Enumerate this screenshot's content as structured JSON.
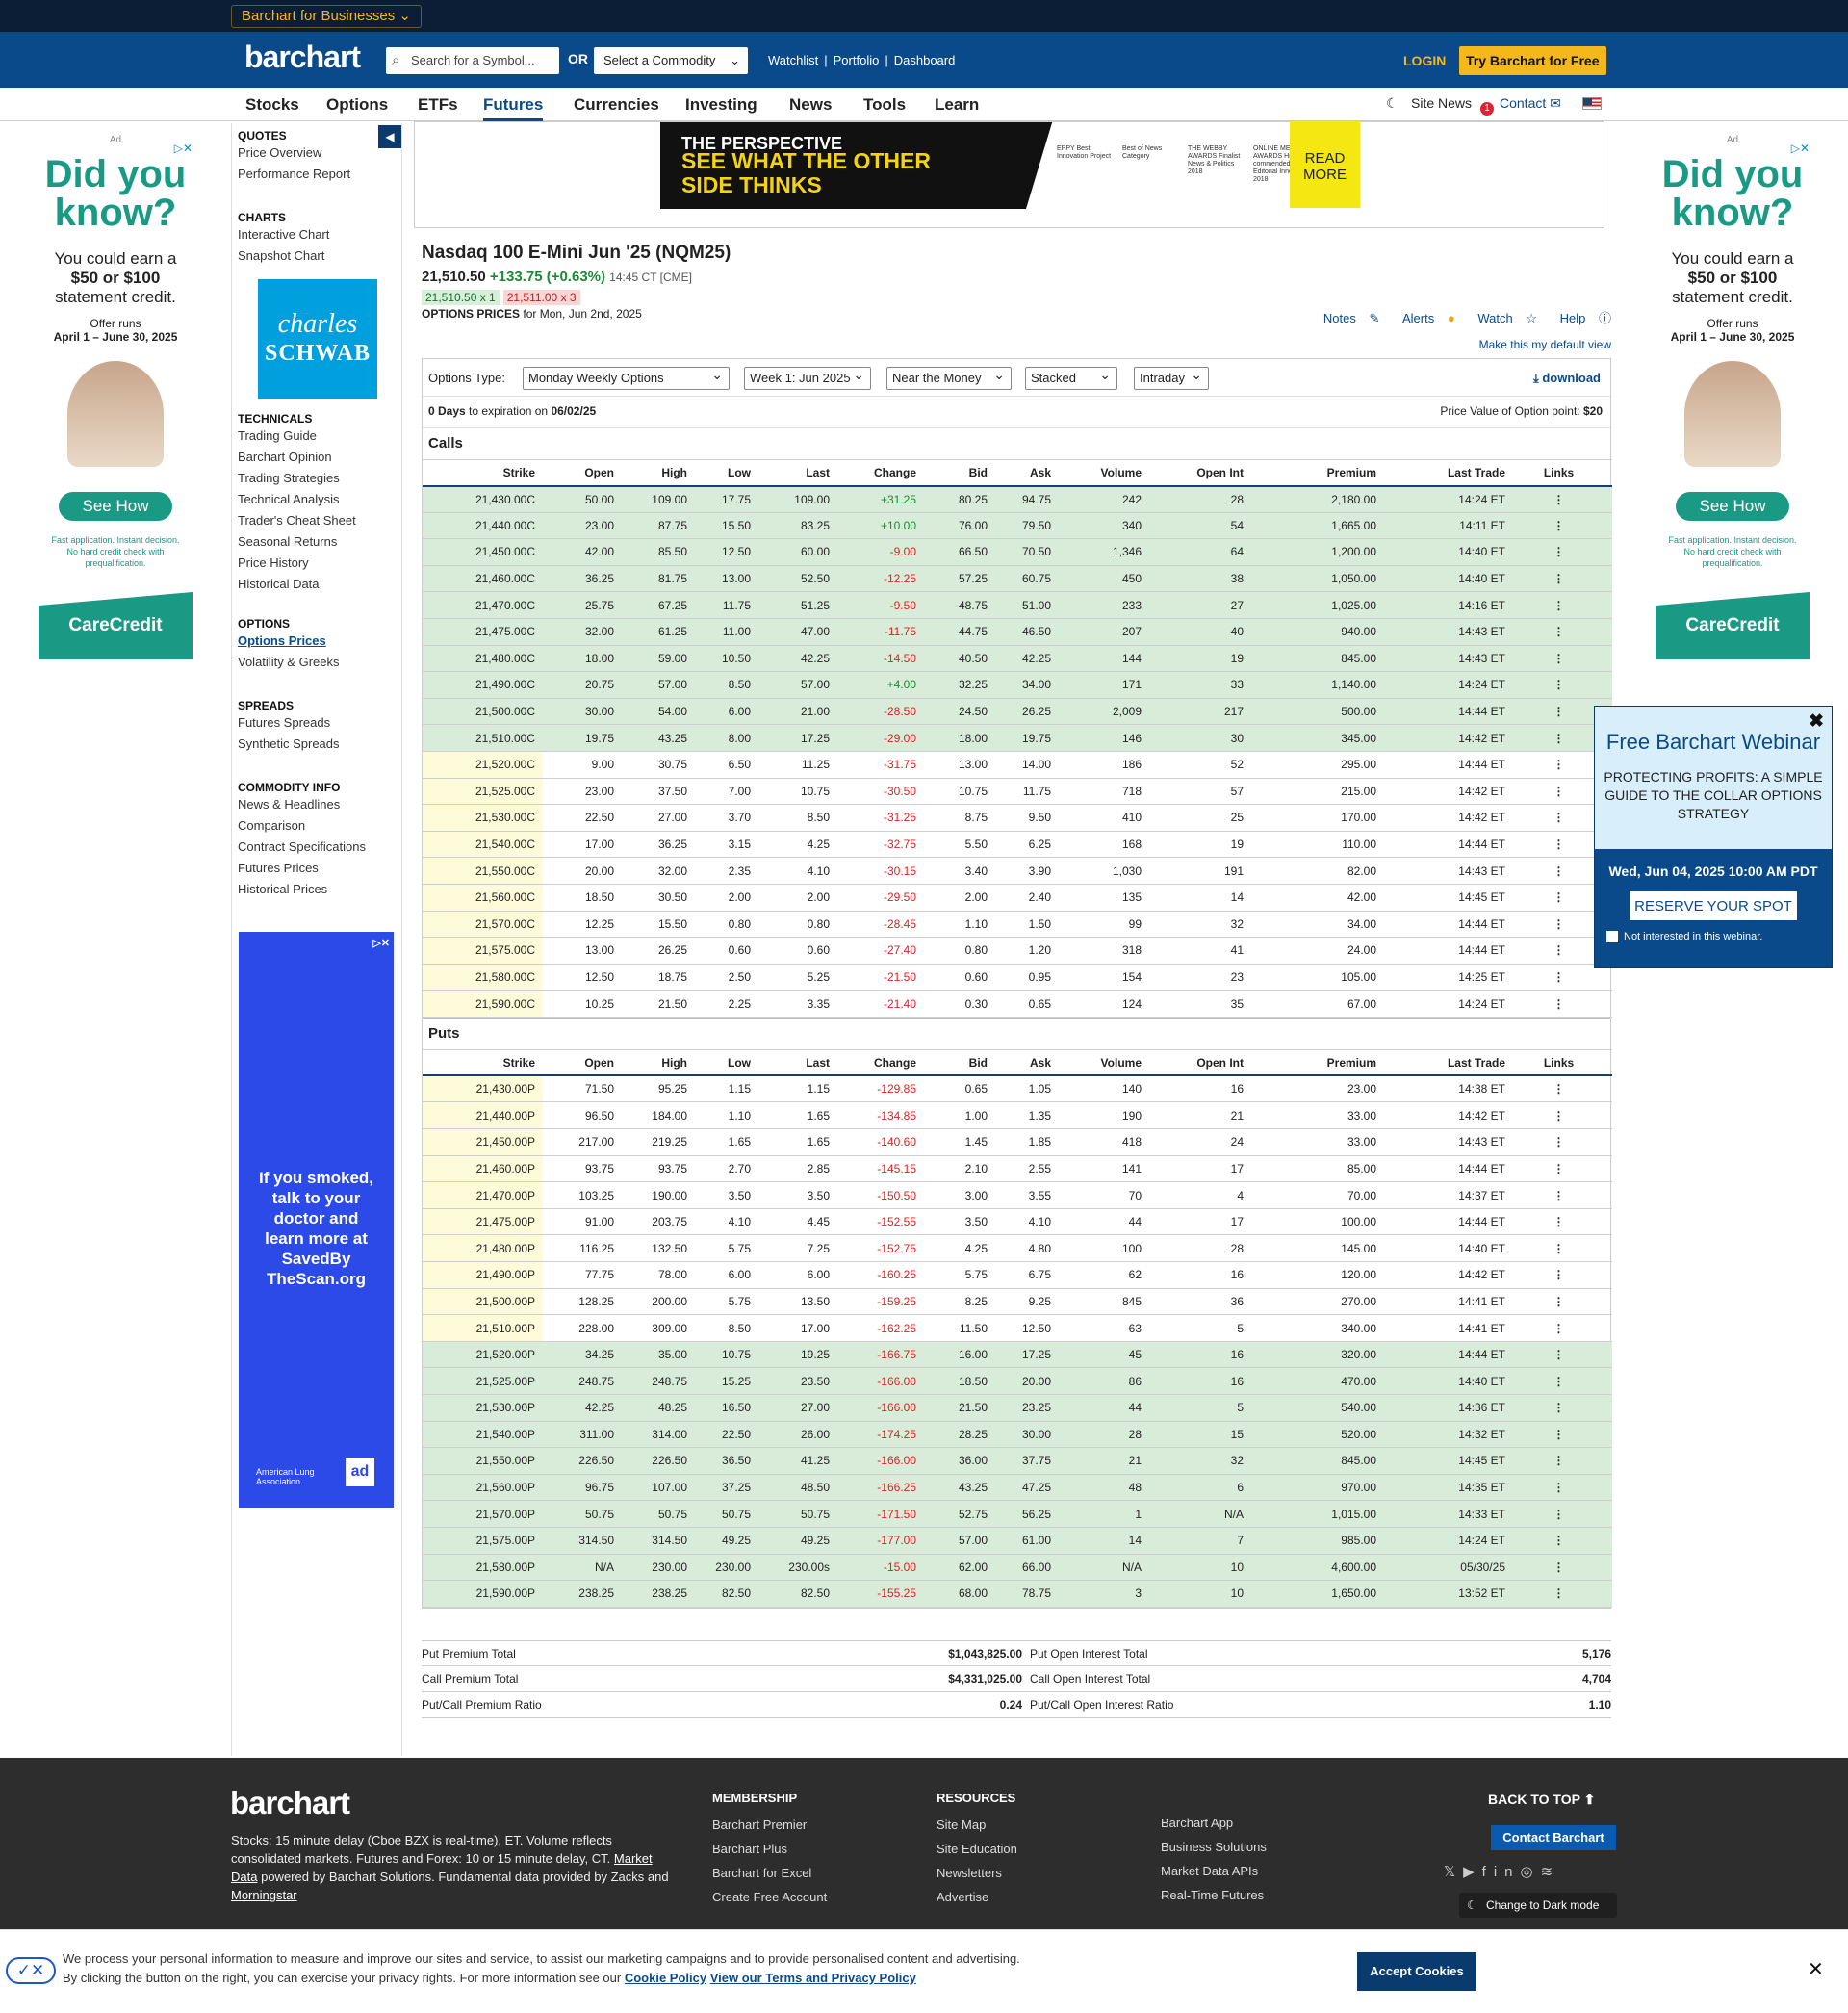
{
  "topbar": {
    "business": "Barchart for Businesses"
  },
  "header": {
    "logo": "barchart",
    "search_placeholder": "Search for a Symbol...",
    "or": "OR",
    "commodity": "Select a Commodity",
    "links": [
      "Watchlist",
      "|",
      "Portfolio",
      "|",
      "Dashboard"
    ],
    "login": "LOGIN",
    "try": "Try Barchart for Free"
  },
  "nav": {
    "items": [
      "Stocks",
      "Options",
      "ETFs",
      "Futures",
      "Currencies",
      "Investing",
      "News",
      "Tools",
      "Learn"
    ],
    "active": "Futures",
    "site_news": "Site News",
    "badge": "1",
    "contact": "Contact"
  },
  "left_ad": {
    "label": "Ad",
    "headline1": "Did you",
    "headline2": "know?",
    "line1": "You could earn a",
    "line2": "$50 or $100",
    "line3": "statement credit.",
    "offer1": "Offer runs",
    "offer2": "April 1 – June 30, 2025",
    "button": "See How",
    "fine": "Fast application. Instant decision. No hard credit check with prequalification.",
    "brand": "CareCredit"
  },
  "sidebar": {
    "quotes": {
      "title": "QUOTES",
      "links": [
        "Price Overview",
        "Performance Report"
      ]
    },
    "charts": {
      "title": "CHARTS",
      "links": [
        "Interactive Chart",
        "Snapshot Chart"
      ]
    },
    "schwab": {
      "name": "charles",
      "name2": "SCHWAB"
    },
    "technicals": {
      "title": "TECHNICALS",
      "links": [
        "Trading Guide",
        "Barchart Opinion",
        "Trading Strategies",
        "Technical Analysis",
        "Trader's Cheat Sheet",
        "Seasonal Returns",
        "Price History",
        "Historical Data"
      ]
    },
    "options": {
      "title": "OPTIONS",
      "current": "Options Prices",
      "links": [
        "Volatility & Greeks"
      ]
    },
    "spreads": {
      "title": "SPREADS",
      "links": [
        "Futures Spreads",
        "Synthetic Spreads"
      ]
    },
    "commodity": {
      "title": "COMMODITY INFO",
      "links": [
        "News & Headlines",
        "Comparison",
        "Contract Specifications",
        "Futures Prices",
        "Historical Prices"
      ]
    },
    "lung_ad": {
      "text": "If you smoked, talk to your doctor and learn more at SavedBy TheScan.org",
      "brand": "American Lung Association.",
      "council": "ad"
    }
  },
  "top_ad": {
    "brand": "THE PERSPECTIVE",
    "line1": "SEE WHAT THE OTHER",
    "line2": "SIDE THINKS",
    "awards": [
      "EPPY Best Innovation Project",
      "Best of News Category",
      "THE WEBBY AWARDS Finalist News & Politics 2018",
      "ONLINE MEDIA AWARDS Highly commended Editorial Innovation 2018"
    ],
    "cta": "READ MORE"
  },
  "quote": {
    "title": "Nasdaq 100 E-Mini Jun '25 (NQM25)",
    "price": "21,510.50",
    "change": "+133.75 (+0.63%)",
    "time": "14:45 CT [CME]",
    "bid": "21,510.50 x 1",
    "ask": "21,511.00 x 3",
    "options_label": "OPTIONS PRICES",
    "options_date": "for Mon, Jun 2nd, 2025"
  },
  "tools": {
    "notes": "Notes",
    "alerts": "Alerts",
    "watch": "Watch",
    "help": "Help",
    "default": "Make this my default view"
  },
  "controls": {
    "type_label": "Options Type:",
    "type": "Monday Weekly Options",
    "week": "Week 1: Jun 2025",
    "money": "Near the Money",
    "view": "Stacked",
    "period": "Intraday",
    "download": "download"
  },
  "expiration": {
    "days": "0 Days",
    "text": "to expiration on",
    "date": "06/02/25",
    "pv_label": "Price Value of Option point:",
    "pv": "$20"
  },
  "headers": [
    "Strike",
    "Open",
    "High",
    "Low",
    "Last",
    "Change",
    "Bid",
    "Ask",
    "Volume",
    "Open Int",
    "Premium",
    "Last Trade",
    "Links"
  ],
  "calls": {
    "title": "Calls",
    "rows": [
      [
        "21,430.00C",
        "50.00",
        "109.00",
        "17.75",
        "109.00",
        "+31.25",
        "80.25",
        "94.75",
        "242",
        "28",
        "2,180.00",
        "14:24 ET"
      ],
      [
        "21,440.00C",
        "23.00",
        "87.75",
        "15.50",
        "83.25",
        "+10.00",
        "76.00",
        "79.50",
        "340",
        "54",
        "1,665.00",
        "14:11 ET"
      ],
      [
        "21,450.00C",
        "42.00",
        "85.50",
        "12.50",
        "60.00",
        "-9.00",
        "66.50",
        "70.50",
        "1,346",
        "64",
        "1,200.00",
        "14:40 ET"
      ],
      [
        "21,460.00C",
        "36.25",
        "81.75",
        "13.00",
        "52.50",
        "-12.25",
        "57.25",
        "60.75",
        "450",
        "38",
        "1,050.00",
        "14:40 ET"
      ],
      [
        "21,470.00C",
        "25.75",
        "67.25",
        "11.75",
        "51.25",
        "-9.50",
        "48.75",
        "51.00",
        "233",
        "27",
        "1,025.00",
        "14:16 ET"
      ],
      [
        "21,475.00C",
        "32.00",
        "61.25",
        "11.00",
        "47.00",
        "-11.75",
        "44.75",
        "46.50",
        "207",
        "40",
        "940.00",
        "14:43 ET"
      ],
      [
        "21,480.00C",
        "18.00",
        "59.00",
        "10.50",
        "42.25",
        "-14.50",
        "40.50",
        "42.25",
        "144",
        "19",
        "845.00",
        "14:43 ET"
      ],
      [
        "21,490.00C",
        "20.75",
        "57.00",
        "8.50",
        "57.00",
        "+4.00",
        "32.25",
        "34.00",
        "171",
        "33",
        "1,140.00",
        "14:24 ET"
      ],
      [
        "21,500.00C",
        "30.00",
        "54.00",
        "6.00",
        "21.00",
        "-28.50",
        "24.50",
        "26.25",
        "2,009",
        "217",
        "500.00",
        "14:44 ET"
      ],
      [
        "21,510.00C",
        "19.75",
        "43.25",
        "8.00",
        "17.25",
        "-29.00",
        "18.00",
        "19.75",
        "146",
        "30",
        "345.00",
        "14:42 ET"
      ],
      [
        "21,520.00C",
        "9.00",
        "30.75",
        "6.50",
        "11.25",
        "-31.75",
        "13.00",
        "14.00",
        "186",
        "52",
        "295.00",
        "14:44 ET"
      ],
      [
        "21,525.00C",
        "23.00",
        "37.50",
        "7.00",
        "10.75",
        "-30.50",
        "10.75",
        "11.75",
        "718",
        "57",
        "215.00",
        "14:42 ET"
      ],
      [
        "21,530.00C",
        "22.50",
        "27.00",
        "3.70",
        "8.50",
        "-31.25",
        "8.75",
        "9.50",
        "410",
        "25",
        "170.00",
        "14:42 ET"
      ],
      [
        "21,540.00C",
        "17.00",
        "36.25",
        "3.15",
        "4.25",
        "-32.75",
        "5.50",
        "6.25",
        "168",
        "19",
        "110.00",
        "14:44 ET"
      ],
      [
        "21,550.00C",
        "20.00",
        "32.00",
        "2.35",
        "4.10",
        "-30.15",
        "3.40",
        "3.90",
        "1,030",
        "191",
        "82.00",
        "14:43 ET"
      ],
      [
        "21,560.00C",
        "18.50",
        "30.50",
        "2.00",
        "2.00",
        "-29.50",
        "2.00",
        "2.40",
        "135",
        "14",
        "42.00",
        "14:45 ET"
      ],
      [
        "21,570.00C",
        "12.25",
        "15.50",
        "0.80",
        "0.80",
        "-28.45",
        "1.10",
        "1.50",
        "99",
        "32",
        "34.00",
        "14:44 ET"
      ],
      [
        "21,575.00C",
        "13.00",
        "26.25",
        "0.60",
        "0.60",
        "-27.40",
        "0.80",
        "1.20",
        "318",
        "41",
        "24.00",
        "14:44 ET"
      ],
      [
        "21,580.00C",
        "12.50",
        "18.75",
        "2.50",
        "5.25",
        "-21.50",
        "0.60",
        "0.95",
        "154",
        "23",
        "105.00",
        "14:25 ET"
      ],
      [
        "21,590.00C",
        "10.25",
        "21.50",
        "2.25",
        "3.35",
        "-21.40",
        "0.30",
        "0.65",
        "124",
        "35",
        "67.00",
        "14:24 ET"
      ]
    ]
  },
  "puts": {
    "title": "Puts",
    "rows": [
      [
        "21,430.00P",
        "71.50",
        "95.25",
        "1.15",
        "1.15",
        "-129.85",
        "0.65",
        "1.05",
        "140",
        "16",
        "23.00",
        "14:38 ET"
      ],
      [
        "21,440.00P",
        "96.50",
        "184.00",
        "1.10",
        "1.65",
        "-134.85",
        "1.00",
        "1.35",
        "190",
        "21",
        "33.00",
        "14:42 ET"
      ],
      [
        "21,450.00P",
        "217.00",
        "219.25",
        "1.65",
        "1.65",
        "-140.60",
        "1.45",
        "1.85",
        "418",
        "24",
        "33.00",
        "14:43 ET"
      ],
      [
        "21,460.00P",
        "93.75",
        "93.75",
        "2.70",
        "2.85",
        "-145.15",
        "2.10",
        "2.55",
        "141",
        "17",
        "85.00",
        "14:44 ET"
      ],
      [
        "21,470.00P",
        "103.25",
        "190.00",
        "3.50",
        "3.50",
        "-150.50",
        "3.00",
        "3.55",
        "70",
        "4",
        "70.00",
        "14:37 ET"
      ],
      [
        "21,475.00P",
        "91.00",
        "203.75",
        "4.10",
        "4.45",
        "-152.55",
        "3.50",
        "4.10",
        "44",
        "17",
        "100.00",
        "14:44 ET"
      ],
      [
        "21,480.00P",
        "116.25",
        "132.50",
        "5.75",
        "7.25",
        "-152.75",
        "4.25",
        "4.80",
        "100",
        "28",
        "145.00",
        "14:40 ET"
      ],
      [
        "21,490.00P",
        "77.75",
        "78.00",
        "6.00",
        "6.00",
        "-160.25",
        "5.75",
        "6.75",
        "62",
        "16",
        "120.00",
        "14:42 ET"
      ],
      [
        "21,500.00P",
        "128.25",
        "200.00",
        "5.75",
        "13.50",
        "-159.25",
        "8.25",
        "9.25",
        "845",
        "36",
        "270.00",
        "14:41 ET"
      ],
      [
        "21,510.00P",
        "228.00",
        "309.00",
        "8.50",
        "17.00",
        "-162.25",
        "11.50",
        "12.50",
        "63",
        "5",
        "340.00",
        "14:41 ET"
      ],
      [
        "21,520.00P",
        "34.25",
        "35.00",
        "10.75",
        "19.25",
        "-166.75",
        "16.00",
        "17.25",
        "45",
        "16",
        "320.00",
        "14:44 ET"
      ],
      [
        "21,525.00P",
        "248.75",
        "248.75",
        "15.25",
        "23.50",
        "-166.00",
        "18.50",
        "20.00",
        "86",
        "16",
        "470.00",
        "14:40 ET"
      ],
      [
        "21,530.00P",
        "42.25",
        "48.25",
        "16.50",
        "27.00",
        "-166.00",
        "21.50",
        "23.25",
        "44",
        "5",
        "540.00",
        "14:36 ET"
      ],
      [
        "21,540.00P",
        "311.00",
        "314.00",
        "22.50",
        "26.00",
        "-174.25",
        "28.25",
        "30.00",
        "28",
        "15",
        "520.00",
        "14:32 ET"
      ],
      [
        "21,550.00P",
        "226.50",
        "226.50",
        "36.50",
        "41.25",
        "-166.00",
        "36.00",
        "37.75",
        "21",
        "32",
        "845.00",
        "14:45 ET"
      ],
      [
        "21,560.00P",
        "96.75",
        "107.00",
        "37.25",
        "48.50",
        "-166.25",
        "43.25",
        "47.25",
        "48",
        "6",
        "970.00",
        "14:35 ET"
      ],
      [
        "21,570.00P",
        "50.75",
        "50.75",
        "50.75",
        "50.75",
        "-171.50",
        "52.75",
        "56.25",
        "1",
        "N/A",
        "1,015.00",
        "14:33 ET"
      ],
      [
        "21,575.00P",
        "314.50",
        "314.50",
        "49.25",
        "49.25",
        "-177.00",
        "57.00",
        "61.00",
        "14",
        "7",
        "985.00",
        "14:24 ET"
      ],
      [
        "21,580.00P",
        "N/A",
        "230.00",
        "230.00",
        "230.00s",
        "-15.00",
        "62.00",
        "66.00",
        "N/A",
        "10",
        "4,600.00",
        "05/30/25"
      ],
      [
        "21,590.00P",
        "238.25",
        "238.25",
        "82.50",
        "82.50",
        "-155.25",
        "68.00",
        "78.75",
        "3",
        "10",
        "1,650.00",
        "13:52 ET"
      ]
    ]
  },
  "totals": {
    "put_prem_l": "Put Premium Total",
    "put_prem": "$1,043,825.00",
    "call_prem_l": "Call Premium Total",
    "call_prem": "$4,331,025.00",
    "ratio_l": "Put/Call Premium Ratio",
    "ratio": "0.24",
    "put_oi_l": "Put Open Interest Total",
    "put_oi": "5,176",
    "call_oi_l": "Call Open Interest Total",
    "call_oi": "4,704",
    "oi_ratio_l": "Put/Call Open Interest Ratio",
    "oi_ratio": "1.10"
  },
  "webinar": {
    "title": "Free Barchart Webinar",
    "subtitle": "PROTECTING PROFITS: A SIMPLE GUIDE TO THE COLLAR OPTIONS STRATEGY",
    "date": "Wed, Jun 04, 2025 10:00 AM PDT",
    "button": "RESERVE YOUR SPOT",
    "opt_out": "Not interested in this webinar."
  },
  "footer": {
    "logo": "barchart",
    "disclaimer": "Stocks: 15 minute delay (Cboe BZX is real-time), ET. Volume reflects consolidated markets. Futures and Forex: 10 or 15 minute delay, CT.",
    "md": "Market Data",
    "powered": "powered by Barchart Solutions. Fundamental data provided by Zacks and",
    "morningstar": "Morningstar",
    "membership": {
      "title": "MEMBERSHIP",
      "links": [
        "Barchart Premier",
        "Barchart Plus",
        "Barchart for Excel",
        "Create Free Account"
      ]
    },
    "resources": {
      "title": "RESOURCES",
      "links": [
        "Site Map",
        "Site Education",
        "Newsletters",
        "Advertise"
      ]
    },
    "more": {
      "links": [
        "Barchart App",
        "Business Solutions",
        "Market Data APIs",
        "Real-Time Futures"
      ]
    },
    "back_top": "BACK TO TOP",
    "contact": "Contact Barchart",
    "dark": "Change to Dark mode"
  },
  "cookie": {
    "text": "We process your personal information to measure and improve our sites and service, to assist our marketing campaigns and to provide personalised content and advertising. By clicking the button on the right, you can exercise your privacy rights. For more information see our",
    "policy": "Cookie Policy",
    "terms": "View our Terms and Privacy Policy",
    "accept": "Accept Cookies"
  }
}
